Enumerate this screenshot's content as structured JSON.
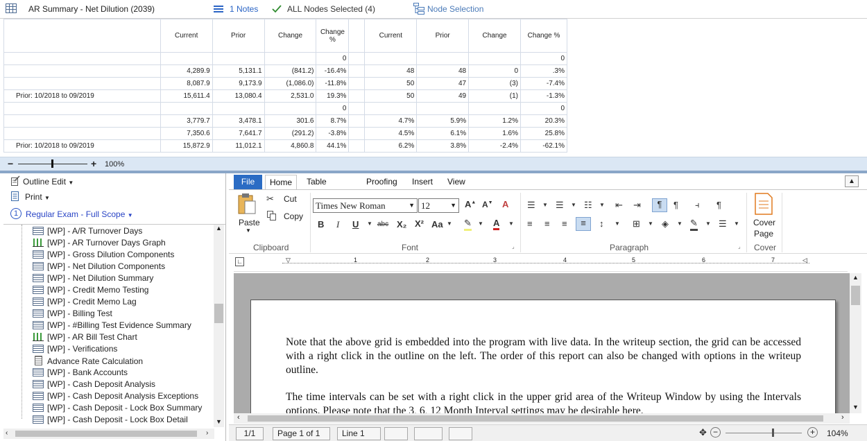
{
  "header": {
    "title": "AR Summary - Net Dilution (2039)",
    "notes": "1 Notes",
    "nodes": "ALL Nodes Selected (4)",
    "node_selection": "Node Selection"
  },
  "grid": {
    "headers": [
      "Current",
      "Prior",
      "Change",
      "Change %",
      "",
      "Current",
      "Prior",
      "Change",
      "Change %"
    ],
    "rows": [
      {
        "label": "",
        "cells": [
          "",
          "",
          "",
          "0",
          "",
          "",
          "",
          "",
          "0"
        ]
      },
      {
        "label": "",
        "cells": [
          "4,289.9",
          "5,131.1",
          "(841.2)",
          "-16.4%",
          "",
          "48",
          "48",
          "0",
          ".3%"
        ]
      },
      {
        "label": "",
        "cells": [
          "8,087.9",
          "9,173.9",
          "(1,086.0)",
          "-11.8%",
          "",
          "50",
          "47",
          "(3)",
          "-7.4%"
        ]
      },
      {
        "label": "Prior: 10/2018 to 09/2019",
        "cells": [
          "15,611.4",
          "13,080.4",
          "2,531.0",
          "19.3%",
          "",
          "50",
          "49",
          "(1)",
          "-1.3%"
        ]
      },
      {
        "label": "",
        "cells": [
          "",
          "",
          "",
          "0",
          "",
          "",
          "",
          "",
          "0"
        ]
      },
      {
        "label": "",
        "cells": [
          "3,779.7",
          "3,478.1",
          "301.6",
          "8.7%",
          "",
          "4.7%",
          "5.9%",
          "1.2%",
          "20.3%"
        ]
      },
      {
        "label": "",
        "cells": [
          "7,350.6",
          "7,641.7",
          "(291.2)",
          "-3.8%",
          "",
          "4.5%",
          "6.1%",
          "1.6%",
          "25.8%"
        ]
      },
      {
        "label": "Prior: 10/2018 to 09/2019",
        "cells": [
          "15,872.9",
          "11,012.1",
          "4,860.8",
          "44.1%",
          "",
          "6.2%",
          "3.8%",
          "-2.4%",
          "-62.1%"
        ]
      }
    ]
  },
  "zoom": {
    "minus": "−",
    "plus": "+",
    "percent": "100%"
  },
  "left_panel": {
    "outline_edit": "Outline Edit",
    "print": "Print",
    "exam": "Regular Exam - Full Scope",
    "exam_number": "1",
    "items": [
      {
        "label": "[WP] - A/R Turnover Days",
        "icon": "grid"
      },
      {
        "label": "[WP] - AR Turnover Days Graph",
        "icon": "graph"
      },
      {
        "label": "[WP] - Gross Dilution Components",
        "icon": "grid"
      },
      {
        "label": "[WP] - Net Dilution Components",
        "icon": "grid"
      },
      {
        "label": "[WP] - Net Dilution Summary",
        "icon": "grid"
      },
      {
        "label": "[WP] - Credit Memo Testing",
        "icon": "grid"
      },
      {
        "label": "[WP] - Credit Memo Lag",
        "icon": "grid"
      },
      {
        "label": "[WP] - Billing Test",
        "icon": "grid"
      },
      {
        "label": "[WP] - #Billing Test Evidence Summary",
        "icon": "grid"
      },
      {
        "label": "[WP] - AR Bill Test Chart",
        "icon": "graph"
      },
      {
        "label": "[WP] - Verifications",
        "icon": "grid"
      },
      {
        "label": "Advance Rate Calculation",
        "icon": "doc"
      },
      {
        "label": "[WP] - Bank Accounts",
        "icon": "grid"
      },
      {
        "label": "[WP] - Cash Deposit Analysis",
        "icon": "grid"
      },
      {
        "label": "[WP] - Cash Deposit Analysis Exceptions",
        "icon": "grid"
      },
      {
        "label": "[WP] - Cash Deposit - Lock Box Summary",
        "icon": "grid"
      },
      {
        "label": "[WP] - Cash Deposit - Lock Box Detail",
        "icon": "grid"
      }
    ]
  },
  "ribbon": {
    "tabs": [
      "File",
      "Home",
      "Table Layout",
      "Proofing",
      "Insert",
      "View"
    ],
    "clipboard": {
      "paste": "Paste",
      "cut": "Cut",
      "copy": "Copy",
      "label": "Clipboard"
    },
    "font": {
      "family": "Times New Roman",
      "size": "12",
      "label": "Font",
      "bold": "B",
      "italic": "I",
      "underline": "U",
      "strike": "abc",
      "sub": "X₂",
      "sup": "X²",
      "case": "Aa"
    },
    "paragraph": {
      "label": "Paragraph"
    },
    "cover": {
      "button": "Cover Page",
      "label": "Cover"
    }
  },
  "ruler": {
    "marks": [
      "1",
      "2",
      "3",
      "4",
      "5",
      "6",
      "7"
    ]
  },
  "document": {
    "para1": "Note that the above grid is embedded into the program with live data.  In the writeup section, the grid can be accessed with a right click in the outline on the left.  The order of this report can also be changed with options in the writeup outline.",
    "para2": "The time intervals can be set with a right click in the upper grid area of the Writeup Window by using the Intervals options.  Please note that the 3, 6, 12 Month Interval settings may be desirable here."
  },
  "status": {
    "section": "1/1",
    "page": "Page 1 of 1",
    "line": "Line 1",
    "zoom": "104%"
  }
}
